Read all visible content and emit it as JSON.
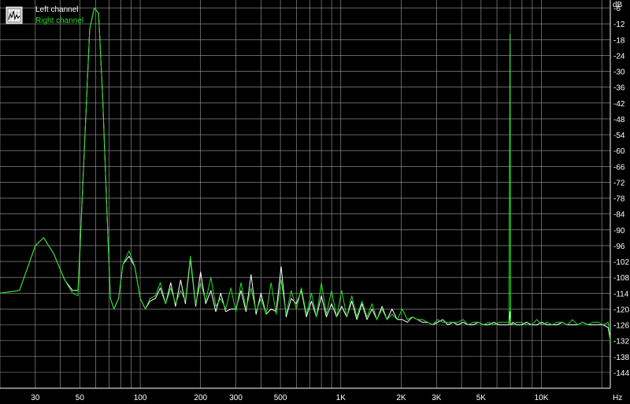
{
  "chart_data": {
    "type": "line",
    "x_unit": "Hz",
    "y_unit": "dB",
    "x_scale": "log",
    "xlim": [
      20,
      22050
    ],
    "ylim": [
      -150,
      -3
    ],
    "grid": true,
    "legend_position": "top-left",
    "x_ticks": [
      {
        "value": 30,
        "label": "30"
      },
      {
        "value": 50,
        "label": "50"
      },
      {
        "value": 100,
        "label": "100"
      },
      {
        "value": 200,
        "label": "200"
      },
      {
        "value": 300,
        "label": "300"
      },
      {
        "value": 500,
        "label": "500"
      },
      {
        "value": 1000,
        "label": "1K"
      },
      {
        "value": 2000,
        "label": "2K"
      },
      {
        "value": 3000,
        "label": "3K"
      },
      {
        "value": 5000,
        "label": "5K"
      },
      {
        "value": 10000,
        "label": "10K"
      }
    ],
    "y_ticks": [
      -6,
      -12,
      -18,
      -24,
      -30,
      -36,
      -42,
      -48,
      -54,
      -60,
      -66,
      -72,
      -78,
      -84,
      -90,
      -96,
      -102,
      -108,
      -114,
      -120,
      -126,
      -132,
      -138,
      -144
    ],
    "colors": {
      "background": "#000000",
      "grid": "#a0a0a0",
      "text": "#ffffff",
      "left_channel": "#ffffff",
      "right_channel": "#22dd22"
    },
    "legend_icon": "spectrum-analyzer-icon",
    "series": [
      {
        "name": "Left channel",
        "x": [
          20,
          25,
          30,
          33,
          37,
          42,
          46,
          49,
          53,
          56,
          59,
          62,
          65,
          68,
          71,
          74,
          78,
          82,
          88,
          94,
          100,
          106,
          112,
          119,
          126,
          134,
          142,
          150,
          159,
          168,
          178,
          189,
          200,
          212,
          225,
          238,
          252,
          267,
          283,
          300,
          318,
          337,
          357,
          378,
          400,
          424,
          449,
          476,
          504,
          534,
          566,
          600,
          636,
          674,
          714,
          756,
          800,
          848,
          899,
          953,
          1010,
          1070,
          1134,
          1202,
          1274,
          1350,
          1430,
          1515,
          1605,
          1700,
          1800,
          1910,
          2025,
          2145,
          2275,
          2410,
          2555,
          2710,
          2870,
          3040,
          3225,
          3420,
          3625,
          3840,
          4070,
          4315,
          4575,
          4850,
          5140,
          5450,
          5780,
          6130,
          6500,
          6890,
          6970,
          7030,
          7100,
          7200,
          7500,
          7950,
          8430,
          8940,
          9480,
          10050,
          10660,
          11300,
          11980,
          12700,
          13470,
          14280,
          15140,
          16050,
          17020,
          18040,
          19130,
          20280,
          21500,
          22050
        ],
        "values": [
          -114,
          -113,
          -96,
          -93,
          -99,
          -109,
          -113,
          -113,
          -55,
          -14,
          -6,
          -8,
          -40,
          -80,
          -116,
          -120,
          -116,
          -103,
          -100,
          -104,
          -116,
          -120,
          -117,
          -116,
          -112,
          -118,
          -110,
          -119,
          -109,
          -118,
          -101,
          -119,
          -106,
          -118,
          -113,
          -121,
          -114,
          -121,
          -120,
          -120,
          -113,
          -121,
          -107,
          -122,
          -114,
          -122,
          -120,
          -121,
          -104,
          -123,
          -116,
          -118,
          -113,
          -123,
          -117,
          -123,
          -115,
          -123,
          -118,
          -123,
          -119,
          -123,
          -117,
          -124,
          -118,
          -124,
          -120,
          -124,
          -119,
          -124,
          -120,
          -124,
          -124,
          -125,
          -123,
          -124,
          -125,
          -125,
          -126,
          -125,
          -124,
          -126,
          -125,
          -126,
          -125,
          -126,
          -126,
          -125,
          -126,
          -126,
          -125,
          -126,
          -126,
          -126,
          -121,
          -126,
          -126,
          -125,
          -126,
          -126,
          -125,
          -126,
          -126,
          -125,
          -126,
          -126,
          -126,
          -125,
          -126,
          -126,
          -126,
          -125,
          -126,
          -126,
          -126,
          -126,
          -127,
          -132
        ]
      },
      {
        "name": "Right channel",
        "x": [
          20,
          25,
          30,
          33,
          37,
          42,
          46,
          49,
          53,
          56,
          59,
          62,
          65,
          68,
          71,
          74,
          78,
          82,
          88,
          94,
          100,
          106,
          112,
          119,
          126,
          134,
          142,
          150,
          159,
          168,
          178,
          189,
          200,
          212,
          225,
          238,
          252,
          267,
          283,
          300,
          318,
          337,
          357,
          378,
          400,
          424,
          449,
          476,
          504,
          534,
          566,
          600,
          636,
          674,
          714,
          756,
          800,
          848,
          899,
          953,
          1010,
          1070,
          1134,
          1202,
          1274,
          1350,
          1430,
          1515,
          1605,
          1700,
          1800,
          1910,
          2025,
          2145,
          2275,
          2410,
          2555,
          2710,
          2870,
          3040,
          3225,
          3420,
          3625,
          3840,
          4070,
          4315,
          4575,
          4850,
          5140,
          5450,
          5780,
          6130,
          6500,
          6890,
          6970,
          7030,
          7100,
          7200,
          7500,
          7950,
          8430,
          8940,
          9480,
          10050,
          10660,
          11300,
          11980,
          12700,
          13470,
          14280,
          15140,
          16050,
          17020,
          18040,
          19130,
          20280,
          21500,
          22050
        ],
        "values": [
          -114,
          -113,
          -96,
          -93,
          -99,
          -109,
          -114,
          -115,
          -55,
          -14,
          -6,
          -8,
          -40,
          -80,
          -116,
          -120,
          -116,
          -103,
          -98,
          -104,
          -116,
          -120,
          -116,
          -115,
          -110,
          -118,
          -112,
          -118,
          -113,
          -117,
          -100,
          -118,
          -110,
          -117,
          -108,
          -119,
          -116,
          -120,
          -112,
          -121,
          -110,
          -120,
          -112,
          -121,
          -116,
          -122,
          -110,
          -122,
          -109,
          -122,
          -113,
          -120,
          -112,
          -122,
          -114,
          -123,
          -110,
          -122,
          -113,
          -123,
          -113,
          -123,
          -115,
          -123,
          -117,
          -123,
          -118,
          -124,
          -120,
          -124,
          -122,
          -124,
          -120,
          -124,
          -123,
          -124,
          -124,
          -125,
          -126,
          -124,
          -125,
          -125,
          -125,
          -125,
          -124,
          -126,
          -125,
          -125,
          -126,
          -125,
          -126,
          -125,
          -125,
          -125,
          -16,
          -125,
          -126,
          -126,
          -125,
          -125,
          -126,
          -126,
          -124,
          -126,
          -125,
          -126,
          -125,
          -125,
          -126,
          -124,
          -126,
          -125,
          -126,
          -125,
          -125,
          -126,
          -125,
          -132
        ]
      }
    ]
  }
}
